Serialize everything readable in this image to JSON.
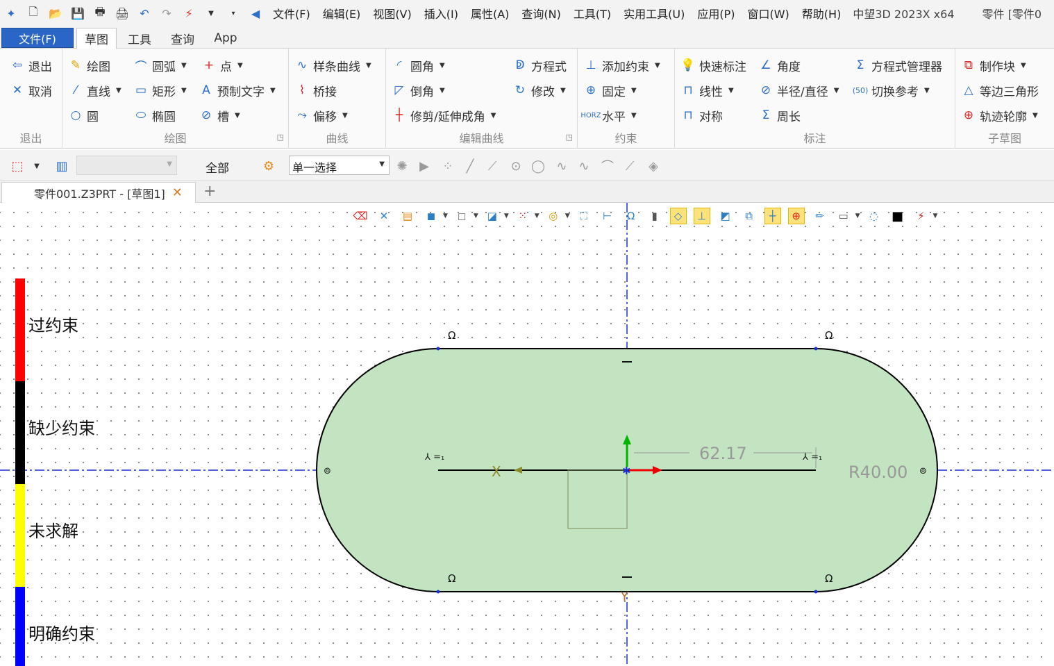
{
  "titlebar": {
    "menus": [
      "文件(F)",
      "编辑(E)",
      "视图(V)",
      "插入(I)",
      "属性(A)",
      "查询(N)",
      "工具(T)",
      "实用工具(U)",
      "应用(P)",
      "窗口(W)",
      "帮助(H)"
    ],
    "app_title": "中望3D 2023X x64",
    "doc_title": "零件 [零件0"
  },
  "ribbon_tabs": {
    "file": "文件(F)",
    "tabs": [
      "草图",
      "工具",
      "查询",
      "App"
    ],
    "active": "草图"
  },
  "ribbon": {
    "exit_group": {
      "label": "退出",
      "exit": "退出",
      "cancel": "取消"
    },
    "draw_group": {
      "label": "绘图",
      "draw": "绘图",
      "line": "直线",
      "circle": "圆",
      "arc": "圆弧",
      "rect": "矩形",
      "ellipse": "椭圆",
      "point": "点",
      "text": "预制文字",
      "slot": "槽"
    },
    "curve_group": {
      "label": "曲线",
      "spline": "样条曲线",
      "bridge": "桥接",
      "offset": "偏移"
    },
    "edit_group": {
      "label": "编辑曲线",
      "fillet": "圆角",
      "chamfer": "倒角",
      "trim": "修剪/延伸成角",
      "equation": "方程式",
      "modify": "修改"
    },
    "constraint_group": {
      "label": "约束",
      "add": "添加约束",
      "fix": "固定",
      "horizontal": "水平"
    },
    "dim_group": {
      "label": "标注",
      "quick": "快速标注",
      "linear": "线性",
      "symmetric": "对称",
      "angle": "角度",
      "radius": "半径/直径",
      "perimeter": "周长",
      "eq_manager": "方程式管理器",
      "toggle_ref": "切换参考"
    },
    "subsketch_group": {
      "label": "子草图",
      "make_block": "制作块",
      "triangle": "等边三角形",
      "trajectory": "轨迹轮廓"
    }
  },
  "selection_toolbar": {
    "filter_all": "全部",
    "select_mode": "单一选择"
  },
  "doc_tab": {
    "label": "零件001.Z3PRT - [草图1]"
  },
  "legend": [
    {
      "label": "过约束",
      "color": "#ff0000"
    },
    {
      "label": "缺少约束",
      "color": "#000000"
    },
    {
      "label": "未求解",
      "color": "#ffff00"
    },
    {
      "label": "明确约束",
      "color": "#0000ff"
    }
  ],
  "sketch": {
    "dimension_length": "62.17",
    "dimension_radius": "R40.00",
    "axis_label_x": "X",
    "axis_label_y": "Y",
    "fill_color": "#c2e4c1",
    "axis_color": "#1a2fd6"
  }
}
